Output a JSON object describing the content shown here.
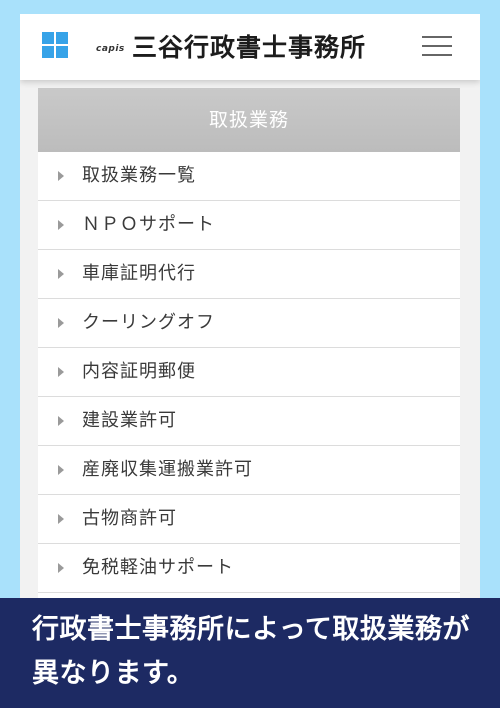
{
  "header": {
    "brand_sub": "capis",
    "brand_name": "三谷行政書士事務所",
    "app_icon": "grid-logo-icon",
    "menu_icon": "hamburger-menu-icon"
  },
  "panel": {
    "title": "取扱業務",
    "items": [
      {
        "label": "取扱業務一覧"
      },
      {
        "label": "ＮＰＯサポート"
      },
      {
        "label": "車庫証明代行"
      },
      {
        "label": "クーリングオフ"
      },
      {
        "label": "内容証明郵便"
      },
      {
        "label": "建設業許可"
      },
      {
        "label": "産廃収集運搬業許可"
      },
      {
        "label": "古物商許可"
      },
      {
        "label": "免税軽油サポート"
      }
    ]
  },
  "caption": {
    "text": "行政書士事務所によって取扱業務が異なります。"
  },
  "colors": {
    "background": "#a9e1fb",
    "accent": "#36a3e8",
    "caption_bg": "#1d2a63",
    "panel_header": "#c4c4c4"
  }
}
